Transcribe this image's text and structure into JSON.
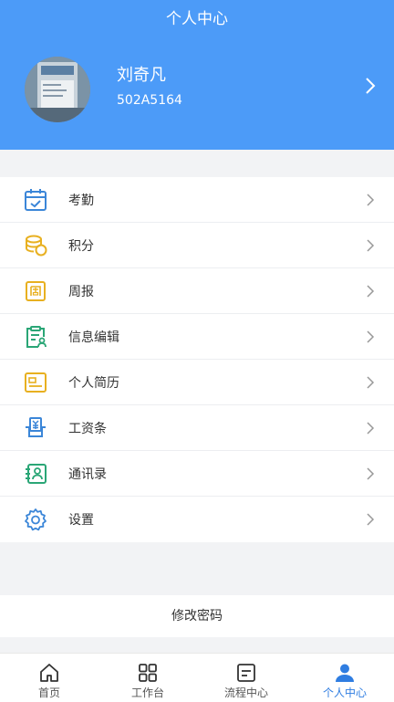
{
  "header": {
    "title": "个人中心",
    "user_name": "刘奇凡",
    "user_id": "502A5164",
    "background_color": "#4c9bf8"
  },
  "menu": {
    "items": [
      {
        "label": "考勤",
        "icon": "calendar-check-icon",
        "color": "#3b86d8"
      },
      {
        "label": "积分",
        "icon": "coins-icon",
        "color": "#e8b020"
      },
      {
        "label": "周报",
        "icon": "weekly-report-icon",
        "color": "#e8b020"
      },
      {
        "label": "信息编辑",
        "icon": "clipboard-user-icon",
        "color": "#2aa676"
      },
      {
        "label": "个人简历",
        "icon": "resume-card-icon",
        "color": "#e8b020"
      },
      {
        "label": "工资条",
        "icon": "salary-icon",
        "color": "#3b86d8"
      },
      {
        "label": "通讯录",
        "icon": "contacts-icon",
        "color": "#2aa676"
      },
      {
        "label": "设置",
        "icon": "gear-icon",
        "color": "#3b86d8"
      }
    ]
  },
  "password": {
    "label": "修改密码"
  },
  "tabbar": {
    "tabs": [
      {
        "label": "首页",
        "icon": "home-icon",
        "active": false
      },
      {
        "label": "工作台",
        "icon": "grid-icon",
        "active": false
      },
      {
        "label": "流程中心",
        "icon": "process-icon",
        "active": false
      },
      {
        "label": "个人中心",
        "icon": "person-icon",
        "active": true
      }
    ],
    "active_color": "#2f7de1"
  }
}
